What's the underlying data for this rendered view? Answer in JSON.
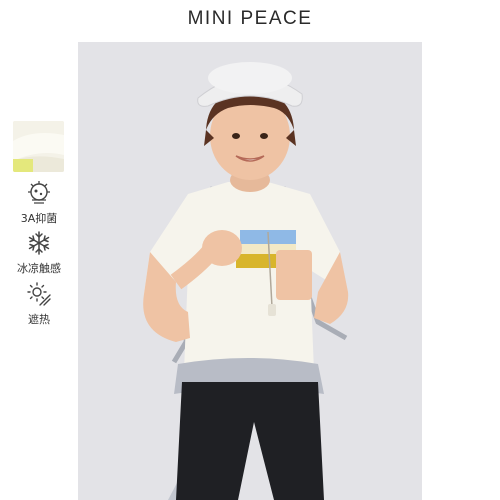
{
  "brand": {
    "name": "MINI PEACE"
  },
  "features": [
    {
      "label": "3A抑菌",
      "icon": "antibacterial-icon"
    },
    {
      "label": "冰凉触感",
      "icon": "snowflake-icon"
    },
    {
      "label": "遮热",
      "icon": "sun-shade-icon"
    }
  ],
  "colors": {
    "backdrop": "#e3e3e7",
    "tshirt": "#f6f4ec",
    "patch_blue": "#8fb9e6",
    "patch_yellow": "#d8b52c",
    "shorts": "#1f2024",
    "jacket": "#b8bcc6"
  }
}
